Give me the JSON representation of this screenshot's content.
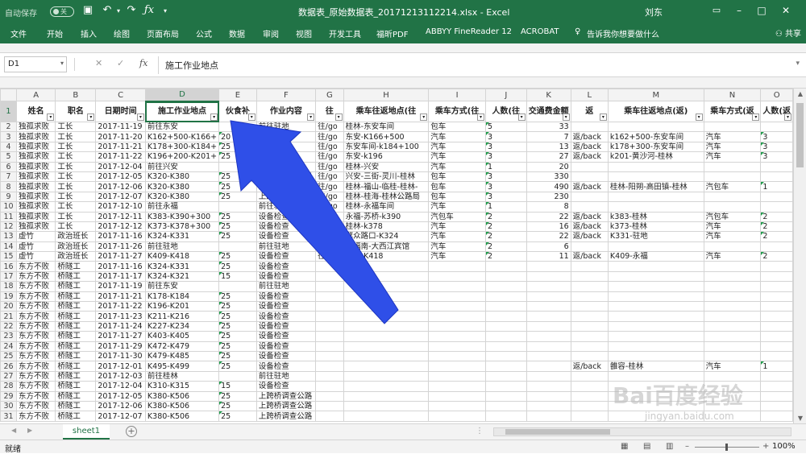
{
  "titlebar": {
    "autosave_label": "自动保存",
    "autosave_state": "关",
    "doc_title": "数据表_原始数据表_20171213112214.xlsx - Excel",
    "user": "刘东"
  },
  "ribbon": {
    "tabs": [
      "文件",
      "开始",
      "插入",
      "绘图",
      "页面布局",
      "公式",
      "数据",
      "审阅",
      "视图",
      "开发工具",
      "福昕PDF",
      "ABBYY FineReader 12",
      "ACROBAT",
      "告诉我你想要做什么"
    ],
    "share": "共享"
  },
  "formula_bar": {
    "name_box": "D1",
    "content": "施工作业地点"
  },
  "columns": [
    "A",
    "B",
    "C",
    "D",
    "E",
    "F",
    "G",
    "H",
    "I",
    "J",
    "K",
    "L",
    "M",
    "N",
    "O"
  ],
  "header_row": [
    "姓名",
    "职名",
    "日期时间",
    "施工作业地点",
    "伙食补",
    "作业内容",
    "往",
    "乘车往返地点(往",
    "乘车方式(往",
    "人数(往",
    "交通费金额",
    "返",
    "乘车往返地点(返)",
    "乘车方式(返",
    "人数(返"
  ],
  "rows": [
    [
      "独孤求败",
      "工长",
      "2017-11-19",
      "前往东安",
      "",
      "前往驻地",
      "往/go",
      "桂林-东安车间",
      "包车",
      "5",
      "33",
      "",
      "",
      "",
      ""
    ],
    [
      "独孤求败",
      "工长",
      "2017-11-20",
      "K162+500-K166+",
      "20",
      "设备检查",
      "往/go",
      "东安-K166+500",
      "汽车",
      "3",
      "7",
      "返/back",
      "k162+500-东安车间",
      "汽车",
      "3"
    ],
    [
      "独孤求败",
      "工长",
      "2017-11-21",
      "K178+300-K184+",
      "25",
      "设备检查",
      "往/go",
      "东安车间-k184+100",
      "汽车",
      "3",
      "13",
      "返/back",
      "k178+300-东安车间",
      "汽车",
      "3"
    ],
    [
      "独孤求败",
      "工长",
      "2017-11-22",
      "K196+200-K201+",
      "25",
      "设备检查",
      "往/go",
      "东安-k196",
      "汽车",
      "3",
      "27",
      "返/back",
      "k201-黄沙河-桂林",
      "汽车",
      "3"
    ],
    [
      "独孤求败",
      "工长",
      "2017-12-04",
      "前往兴安",
      "",
      "前往驻地",
      "往/go",
      "桂林-兴安",
      "汽车",
      "1",
      "20",
      "",
      "",
      "",
      ""
    ],
    [
      "独孤求败",
      "工长",
      "2017-12-05",
      "K320-K380",
      "25",
      "上跨桥调查公路",
      "往/go",
      "兴安-三街-灵川-桂林",
      "包车",
      "3",
      "330",
      "",
      "",
      "",
      ""
    ],
    [
      "独孤求败",
      "工长",
      "2017-12-06",
      "K320-K380",
      "25",
      "上跨桥调查公路",
      "往/go",
      "桂林-福山-临桂-桂林-",
      "包车",
      "3",
      "490",
      "返/back",
      "桂林-阳朔-高田镇-桂林",
      "汽包车",
      "1"
    ],
    [
      "独孤求败",
      "工长",
      "2017-12-07",
      "K320-K380",
      "25",
      "上跨桥调查公路",
      "往/go",
      "桂林-桂海-桂林公路局",
      "包车",
      "3",
      "230",
      "",
      "",
      "",
      ""
    ],
    [
      "独孤求败",
      "工长",
      "2017-12-10",
      "前往永福",
      "",
      "前往驻地",
      "往/go",
      "桂林-永福车间",
      "汽车",
      "1",
      "8",
      "",
      "",
      "",
      ""
    ],
    [
      "独孤求败",
      "工长",
      "2017-12-11",
      "K383-K390+300",
      "25",
      "设备检查",
      "往/go",
      "永福-苏桥-k390",
      "汽包车",
      "2",
      "22",
      "返/back",
      "k383-桂林",
      "汽包车",
      "2"
    ],
    [
      "独孤求败",
      "工长",
      "2017-12-12",
      "K373-K378+300",
      "25",
      "设备检查",
      "往/go",
      "桂林-k378",
      "汽车",
      "2",
      "16",
      "返/back",
      "k373-桂林",
      "汽车",
      "2"
    ],
    [
      "虚竹",
      "政治班长",
      "2017-11-16",
      "K324-K331",
      "25",
      "设备检查",
      "往/go",
      "群众路口-K324",
      "汽车",
      "2",
      "22",
      "返/back",
      "K331-驻地",
      "汽车",
      "2"
    ],
    [
      "虚竹",
      "政治班长",
      "2017-11-26",
      "前往驻地",
      "",
      "前往驻地",
      "往/go",
      "永福南-大西江宾馆",
      "汽车",
      "2",
      "6",
      "",
      "",
      "",
      ""
    ],
    [
      "虚竹",
      "政治班长",
      "2017-11-27",
      "K409-K418",
      "25",
      "设备检查",
      "往/go",
      "永福-K418",
      "汽车",
      "2",
      "11",
      "返/back",
      "K409-永福",
      "汽车",
      "2"
    ],
    [
      "东方不败",
      "桥隧工",
      "2017-11-16",
      "K324-K331",
      "25",
      "设备检查",
      "",
      "",
      "",
      "",
      "",
      "",
      "",
      "",
      ""
    ],
    [
      "东方不败",
      "桥隧工",
      "2017-11-17",
      "K324-K321",
      "15",
      "设备检查",
      "",
      "",
      "",
      "",
      "",
      "",
      "",
      "",
      ""
    ],
    [
      "东方不败",
      "桥隧工",
      "2017-11-19",
      "前往东安",
      "",
      "前往驻地",
      "",
      "",
      "",
      "",
      "",
      "",
      "",
      "",
      ""
    ],
    [
      "东方不败",
      "桥隧工",
      "2017-11-21",
      "K178-K184",
      "25",
      "设备检查",
      "",
      "",
      "",
      "",
      "",
      "",
      "",
      "",
      ""
    ],
    [
      "东方不败",
      "桥隧工",
      "2017-11-22",
      "K196-K201",
      "25",
      "设备检查",
      "",
      "",
      "",
      "",
      "",
      "",
      "",
      "",
      ""
    ],
    [
      "东方不败",
      "桥隧工",
      "2017-11-23",
      "K211-K216",
      "25",
      "设备检查",
      "",
      "",
      "",
      "",
      "",
      "",
      "",
      "",
      ""
    ],
    [
      "东方不败",
      "桥隧工",
      "2017-11-24",
      "K227-K234",
      "25",
      "设备检查",
      "",
      "",
      "",
      "",
      "",
      "",
      "",
      "",
      ""
    ],
    [
      "东方不败",
      "桥隧工",
      "2017-11-27",
      "K403-K405",
      "25",
      "设备检查",
      "",
      "",
      "",
      "",
      "",
      "",
      "",
      "",
      ""
    ],
    [
      "东方不败",
      "桥隧工",
      "2017-11-29",
      "K472-K479",
      "25",
      "设备检查",
      "",
      "",
      "",
      "",
      "",
      "",
      "",
      "",
      ""
    ],
    [
      "东方不败",
      "桥隧工",
      "2017-11-30",
      "K479-K485",
      "25",
      "设备检查",
      "",
      "",
      "",
      "",
      "",
      "",
      "",
      "",
      ""
    ],
    [
      "东方不败",
      "桥隧工",
      "2017-12-01",
      "K495-K499",
      "25",
      "设备检查",
      "",
      "",
      "",
      "",
      "",
      "返/back",
      "雒容-桂林",
      "汽车",
      "1"
    ],
    [
      "东方不败",
      "桥隧工",
      "2017-12-03",
      "前往桂林",
      "",
      "前往驻地",
      "",
      "",
      "",
      "",
      "",
      "",
      "",
      "",
      ""
    ],
    [
      "东方不败",
      "桥隧工",
      "2017-12-04",
      "K310-K315",
      "15",
      "设备检查",
      "",
      "",
      "",
      "",
      "",
      "",
      "",
      "",
      ""
    ],
    [
      "东方不败",
      "桥隧工",
      "2017-12-05",
      "K380-K506",
      "25",
      "上跨桥调查公路",
      "",
      "",
      "",
      "",
      "",
      "",
      "",
      "",
      ""
    ],
    [
      "东方不败",
      "桥隧工",
      "2017-12-06",
      "K380-K506",
      "25",
      "上跨桥调查公路",
      "",
      "",
      "",
      "",
      "",
      "",
      "",
      "",
      ""
    ],
    [
      "东方不败",
      "桥隧工",
      "2017-12-07",
      "K380-K506",
      "25",
      "上跨桥调查公路",
      "",
      "",
      "",
      "",
      "",
      "",
      "",
      "",
      ""
    ]
  ],
  "sheet_tab": "sheet1",
  "status": {
    "ready": "就绪",
    "zoom": "100%"
  },
  "watermark": {
    "logo": "Bai百度经验",
    "url": "jingyan.baidu.com"
  },
  "colors": {
    "accent": "#217346",
    "arrow": "#2f4fe8"
  },
  "icons": [
    "save-icon",
    "undo-icon",
    "redo-icon",
    "fx-icon",
    "filter-dropdown-icon",
    "lightbulb-icon",
    "person-icon"
  ]
}
